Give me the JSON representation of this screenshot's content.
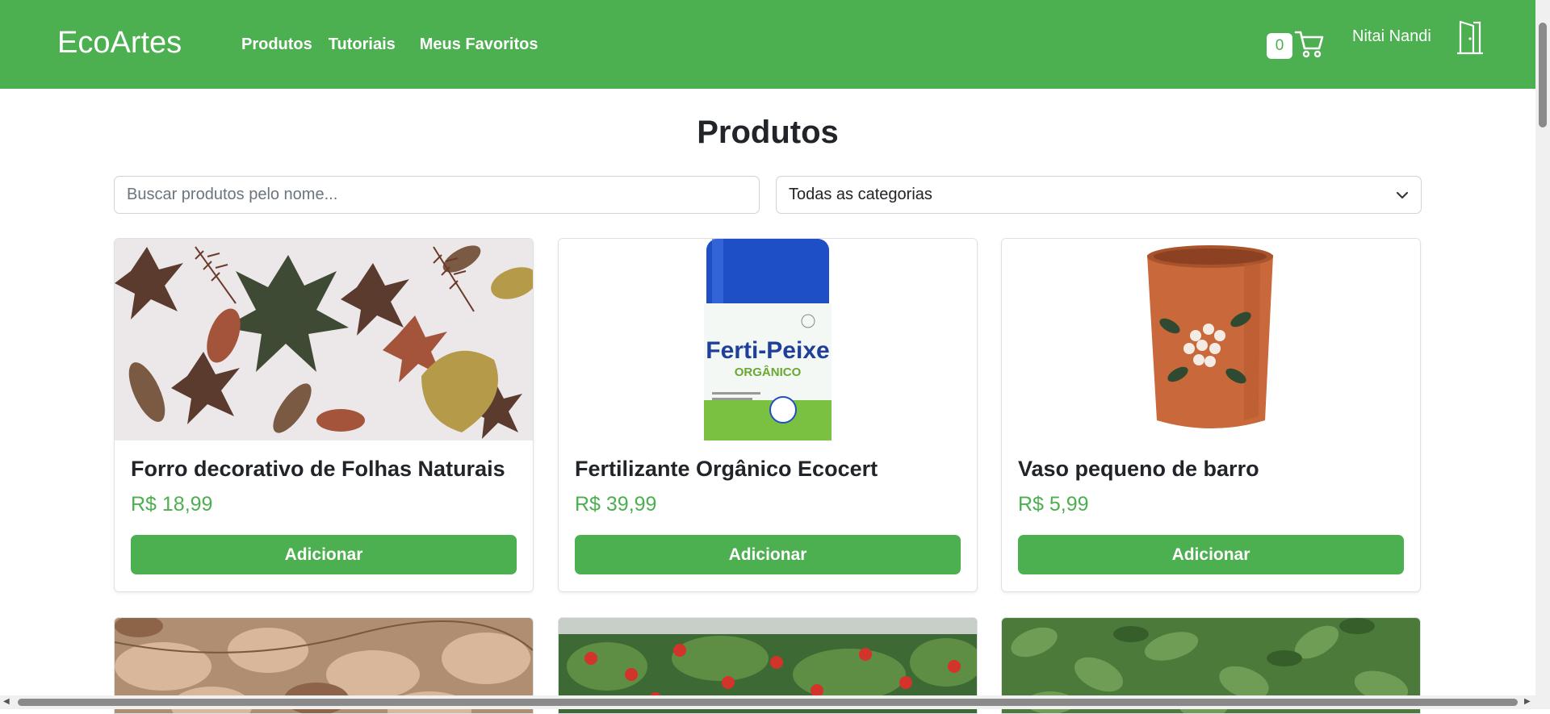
{
  "navbar": {
    "brand": "EcoArtes",
    "links": [
      {
        "label": "Produtos"
      },
      {
        "label": "Tutoriais"
      },
      {
        "label": "Meus Favoritos"
      }
    ],
    "cart_count": "0",
    "cart_icon": "cart-icon",
    "user_name": "Nitai Nandi",
    "logout_icon": "door-icon"
  },
  "main": {
    "title": "Produtos",
    "search_placeholder": "Buscar produtos pelo nome...",
    "category_selected": "Todas as categorias"
  },
  "products": [
    {
      "name": "Forro decorativo de Folhas Naturais",
      "price": "R$ 18,99",
      "button": "Adicionar"
    },
    {
      "name": "Fertilizante Orgânico Ecocert",
      "price": "R$ 39,99",
      "button": "Adicionar",
      "label_text": "Ferti-Peixe",
      "label_sub": "ORGÂNICO"
    },
    {
      "name": "Vaso pequeno de barro",
      "price": "R$ 5,99",
      "button": "Adicionar"
    }
  ],
  "colors": {
    "brand_green": "#4caf50",
    "text": "#212529",
    "border": "#dee2e6"
  }
}
